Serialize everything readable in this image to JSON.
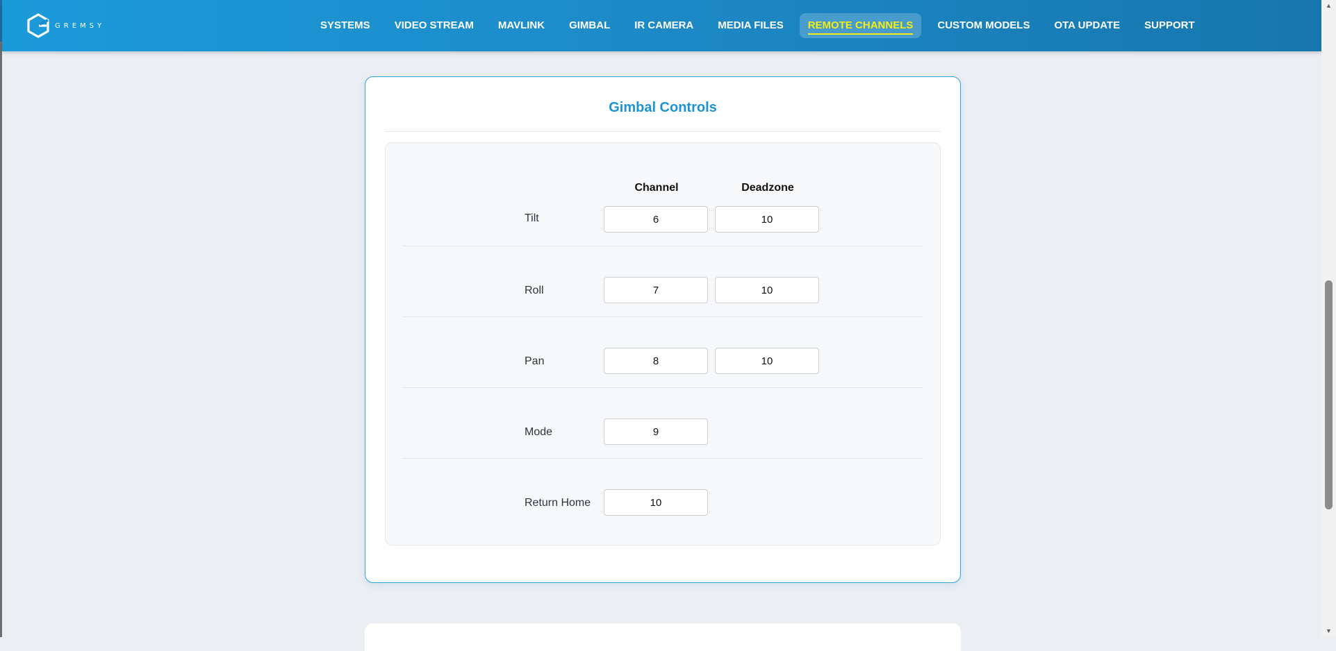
{
  "brand": {
    "logo_text": "GREMSY"
  },
  "nav": {
    "items": [
      {
        "label": "SYSTEMS"
      },
      {
        "label": "VIDEO STREAM"
      },
      {
        "label": "MAVLINK"
      },
      {
        "label": "GIMBAL"
      },
      {
        "label": "IR CAMERA"
      },
      {
        "label": "MEDIA FILES"
      },
      {
        "label": "REMOTE CHANNELS"
      },
      {
        "label": "CUSTOM MODELS"
      },
      {
        "label": "OTA UPDATE"
      },
      {
        "label": "SUPPORT"
      }
    ],
    "active": "REMOTE CHANNELS"
  },
  "gimbal_controls": {
    "title": "Gimbal Controls",
    "headers": {
      "channel": "Channel",
      "deadzone": "Deadzone"
    },
    "rows": [
      {
        "label": "Tilt",
        "channel": "6",
        "deadzone": "10"
      },
      {
        "label": "Roll",
        "channel": "7",
        "deadzone": "10"
      },
      {
        "label": "Pan",
        "channel": "8",
        "deadzone": "10"
      },
      {
        "label": "Mode",
        "channel": "9"
      },
      {
        "label": "Return Home",
        "channel": "10"
      }
    ]
  },
  "colors": {
    "accent": "#1d94d2",
    "active_nav_text": "#f5ee15",
    "card_border": "#2aa3d9"
  }
}
